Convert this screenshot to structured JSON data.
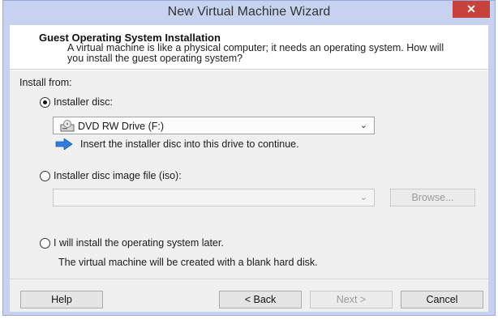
{
  "window": {
    "title": "New Virtual Machine Wizard",
    "close_label": "✕"
  },
  "header": {
    "title": "Guest Operating System Installation",
    "subtitle": "A virtual machine is like a physical computer; it needs an operating system. How will you install the guest operating system?"
  },
  "install_from": {
    "label": "Install from:",
    "options": [
      {
        "label": "Installer disc:",
        "selected": true
      },
      {
        "label": "Installer disc image file (iso):",
        "selected": false
      },
      {
        "label": "I will install the operating system later.",
        "selected": false
      }
    ],
    "disc_drive": {
      "selected": "DVD RW Drive (F:)",
      "icon": "dvd-drive-icon"
    },
    "disc_hint": "Insert the installer disc into this drive to continue.",
    "iso_path": "",
    "browse_label": "Browse...",
    "later_note": "The virtual machine will be created with a blank hard disk."
  },
  "footer": {
    "help_label": "Help",
    "back_label": "< Back",
    "next_label": "Next >",
    "cancel_label": "Cancel"
  },
  "colors": {
    "titlebar": "#c6d2f0",
    "close_button": "#c7423a",
    "panel": "#f0f0f0",
    "hint_arrow": "#2f7fd8"
  }
}
